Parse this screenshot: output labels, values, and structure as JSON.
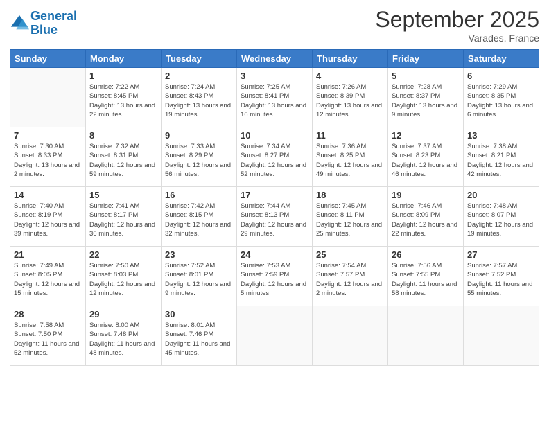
{
  "header": {
    "logo_line1": "General",
    "logo_line2": "Blue",
    "month": "September 2025",
    "location": "Varades, France"
  },
  "weekdays": [
    "Sunday",
    "Monday",
    "Tuesday",
    "Wednesday",
    "Thursday",
    "Friday",
    "Saturday"
  ],
  "weeks": [
    [
      {
        "day": "",
        "sunrise": "",
        "sunset": "",
        "daylight": ""
      },
      {
        "day": "1",
        "sunrise": "Sunrise: 7:22 AM",
        "sunset": "Sunset: 8:45 PM",
        "daylight": "Daylight: 13 hours and 22 minutes."
      },
      {
        "day": "2",
        "sunrise": "Sunrise: 7:24 AM",
        "sunset": "Sunset: 8:43 PM",
        "daylight": "Daylight: 13 hours and 19 minutes."
      },
      {
        "day": "3",
        "sunrise": "Sunrise: 7:25 AM",
        "sunset": "Sunset: 8:41 PM",
        "daylight": "Daylight: 13 hours and 16 minutes."
      },
      {
        "day": "4",
        "sunrise": "Sunrise: 7:26 AM",
        "sunset": "Sunset: 8:39 PM",
        "daylight": "Daylight: 13 hours and 12 minutes."
      },
      {
        "day": "5",
        "sunrise": "Sunrise: 7:28 AM",
        "sunset": "Sunset: 8:37 PM",
        "daylight": "Daylight: 13 hours and 9 minutes."
      },
      {
        "day": "6",
        "sunrise": "Sunrise: 7:29 AM",
        "sunset": "Sunset: 8:35 PM",
        "daylight": "Daylight: 13 hours and 6 minutes."
      }
    ],
    [
      {
        "day": "7",
        "sunrise": "Sunrise: 7:30 AM",
        "sunset": "Sunset: 8:33 PM",
        "daylight": "Daylight: 13 hours and 2 minutes."
      },
      {
        "day": "8",
        "sunrise": "Sunrise: 7:32 AM",
        "sunset": "Sunset: 8:31 PM",
        "daylight": "Daylight: 12 hours and 59 minutes."
      },
      {
        "day": "9",
        "sunrise": "Sunrise: 7:33 AM",
        "sunset": "Sunset: 8:29 PM",
        "daylight": "Daylight: 12 hours and 56 minutes."
      },
      {
        "day": "10",
        "sunrise": "Sunrise: 7:34 AM",
        "sunset": "Sunset: 8:27 PM",
        "daylight": "Daylight: 12 hours and 52 minutes."
      },
      {
        "day": "11",
        "sunrise": "Sunrise: 7:36 AM",
        "sunset": "Sunset: 8:25 PM",
        "daylight": "Daylight: 12 hours and 49 minutes."
      },
      {
        "day": "12",
        "sunrise": "Sunrise: 7:37 AM",
        "sunset": "Sunset: 8:23 PM",
        "daylight": "Daylight: 12 hours and 46 minutes."
      },
      {
        "day": "13",
        "sunrise": "Sunrise: 7:38 AM",
        "sunset": "Sunset: 8:21 PM",
        "daylight": "Daylight: 12 hours and 42 minutes."
      }
    ],
    [
      {
        "day": "14",
        "sunrise": "Sunrise: 7:40 AM",
        "sunset": "Sunset: 8:19 PM",
        "daylight": "Daylight: 12 hours and 39 minutes."
      },
      {
        "day": "15",
        "sunrise": "Sunrise: 7:41 AM",
        "sunset": "Sunset: 8:17 PM",
        "daylight": "Daylight: 12 hours and 36 minutes."
      },
      {
        "day": "16",
        "sunrise": "Sunrise: 7:42 AM",
        "sunset": "Sunset: 8:15 PM",
        "daylight": "Daylight: 12 hours and 32 minutes."
      },
      {
        "day": "17",
        "sunrise": "Sunrise: 7:44 AM",
        "sunset": "Sunset: 8:13 PM",
        "daylight": "Daylight: 12 hours and 29 minutes."
      },
      {
        "day": "18",
        "sunrise": "Sunrise: 7:45 AM",
        "sunset": "Sunset: 8:11 PM",
        "daylight": "Daylight: 12 hours and 25 minutes."
      },
      {
        "day": "19",
        "sunrise": "Sunrise: 7:46 AM",
        "sunset": "Sunset: 8:09 PM",
        "daylight": "Daylight: 12 hours and 22 minutes."
      },
      {
        "day": "20",
        "sunrise": "Sunrise: 7:48 AM",
        "sunset": "Sunset: 8:07 PM",
        "daylight": "Daylight: 12 hours and 19 minutes."
      }
    ],
    [
      {
        "day": "21",
        "sunrise": "Sunrise: 7:49 AM",
        "sunset": "Sunset: 8:05 PM",
        "daylight": "Daylight: 12 hours and 15 minutes."
      },
      {
        "day": "22",
        "sunrise": "Sunrise: 7:50 AM",
        "sunset": "Sunset: 8:03 PM",
        "daylight": "Daylight: 12 hours and 12 minutes."
      },
      {
        "day": "23",
        "sunrise": "Sunrise: 7:52 AM",
        "sunset": "Sunset: 8:01 PM",
        "daylight": "Daylight: 12 hours and 9 minutes."
      },
      {
        "day": "24",
        "sunrise": "Sunrise: 7:53 AM",
        "sunset": "Sunset: 7:59 PM",
        "daylight": "Daylight: 12 hours and 5 minutes."
      },
      {
        "day": "25",
        "sunrise": "Sunrise: 7:54 AM",
        "sunset": "Sunset: 7:57 PM",
        "daylight": "Daylight: 12 hours and 2 minutes."
      },
      {
        "day": "26",
        "sunrise": "Sunrise: 7:56 AM",
        "sunset": "Sunset: 7:55 PM",
        "daylight": "Daylight: 11 hours and 58 minutes."
      },
      {
        "day": "27",
        "sunrise": "Sunrise: 7:57 AM",
        "sunset": "Sunset: 7:52 PM",
        "daylight": "Daylight: 11 hours and 55 minutes."
      }
    ],
    [
      {
        "day": "28",
        "sunrise": "Sunrise: 7:58 AM",
        "sunset": "Sunset: 7:50 PM",
        "daylight": "Daylight: 11 hours and 52 minutes."
      },
      {
        "day": "29",
        "sunrise": "Sunrise: 8:00 AM",
        "sunset": "Sunset: 7:48 PM",
        "daylight": "Daylight: 11 hours and 48 minutes."
      },
      {
        "day": "30",
        "sunrise": "Sunrise: 8:01 AM",
        "sunset": "Sunset: 7:46 PM",
        "daylight": "Daylight: 11 hours and 45 minutes."
      },
      {
        "day": "",
        "sunrise": "",
        "sunset": "",
        "daylight": ""
      },
      {
        "day": "",
        "sunrise": "",
        "sunset": "",
        "daylight": ""
      },
      {
        "day": "",
        "sunrise": "",
        "sunset": "",
        "daylight": ""
      },
      {
        "day": "",
        "sunrise": "",
        "sunset": "",
        "daylight": ""
      }
    ]
  ]
}
